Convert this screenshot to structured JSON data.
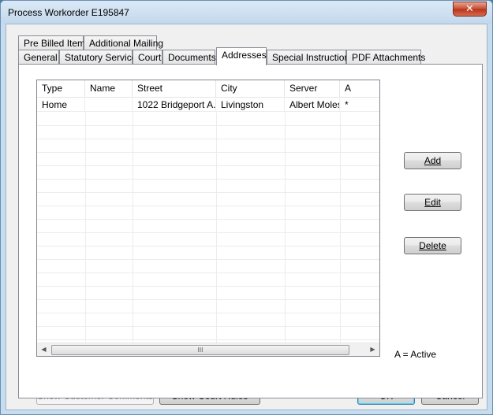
{
  "window": {
    "title": "Process Workorder E195847",
    "close_glyph": "✕"
  },
  "tabs_row1": [
    "Pre Billed Items",
    "Additional Mailing"
  ],
  "tabs_row2": [
    "General",
    "Statutory Service",
    "Court",
    "Documents",
    "Addresses",
    "Special Instructions",
    "PDF Attachments"
  ],
  "active_tab": "Addresses",
  "grid": {
    "columns": [
      "Type",
      "Name",
      "Street",
      "City",
      "Server",
      "A"
    ],
    "rows": [
      {
        "type": "Home",
        "name": "",
        "street": "1022 Bridgeport A...",
        "city": "Livingston",
        "server": "Albert Moles",
        "active": "*"
      }
    ],
    "scroll_grip": "III"
  },
  "side_buttons": {
    "add_label": "Add",
    "edit_label": "Edit",
    "delete_label": "Delete"
  },
  "legend": "A = Active",
  "footer": {
    "show_customer_comments": "Show Customer Comments",
    "show_court_rules": "Show Court Rules",
    "ok": "OK",
    "cancel": "Cancel"
  }
}
